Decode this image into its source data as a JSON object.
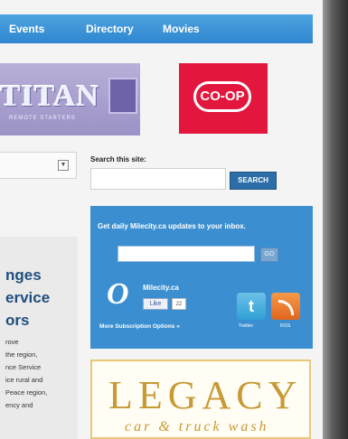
{
  "nav": {
    "items": [
      "Events",
      "Directory",
      "Movies"
    ]
  },
  "ads": {
    "titan": {
      "logo": "TITAN",
      "tagline": "REMOTE STARTERS"
    },
    "coop": {
      "logo": "CO-OP"
    },
    "legacy": {
      "logo": "LEGACY",
      "sub": "car & truck wash"
    }
  },
  "search": {
    "label": "Search this site:",
    "placeholder": "",
    "button": "SEARCH"
  },
  "mailing": {
    "text": "Get daily Milecity.ca updates to your inbox.",
    "email_placeholder": "",
    "go": "GO",
    "site": "Milecity.ca",
    "like": "Like",
    "like_count": "22",
    "options": "More Subscription Options »",
    "twitter_label": "Twitter",
    "rss_label": "RSS"
  },
  "notice": {
    "title": "nges ervice ors",
    "body": "rove\nthe region,\nnce Service\nice rural and\nPeace region,\nency and"
  },
  "colors": {
    "nav": "#2f86cf",
    "coop": "#e3173e",
    "mailing_bg": "#3b8fd0",
    "legacy_gold": "#c79a36"
  }
}
